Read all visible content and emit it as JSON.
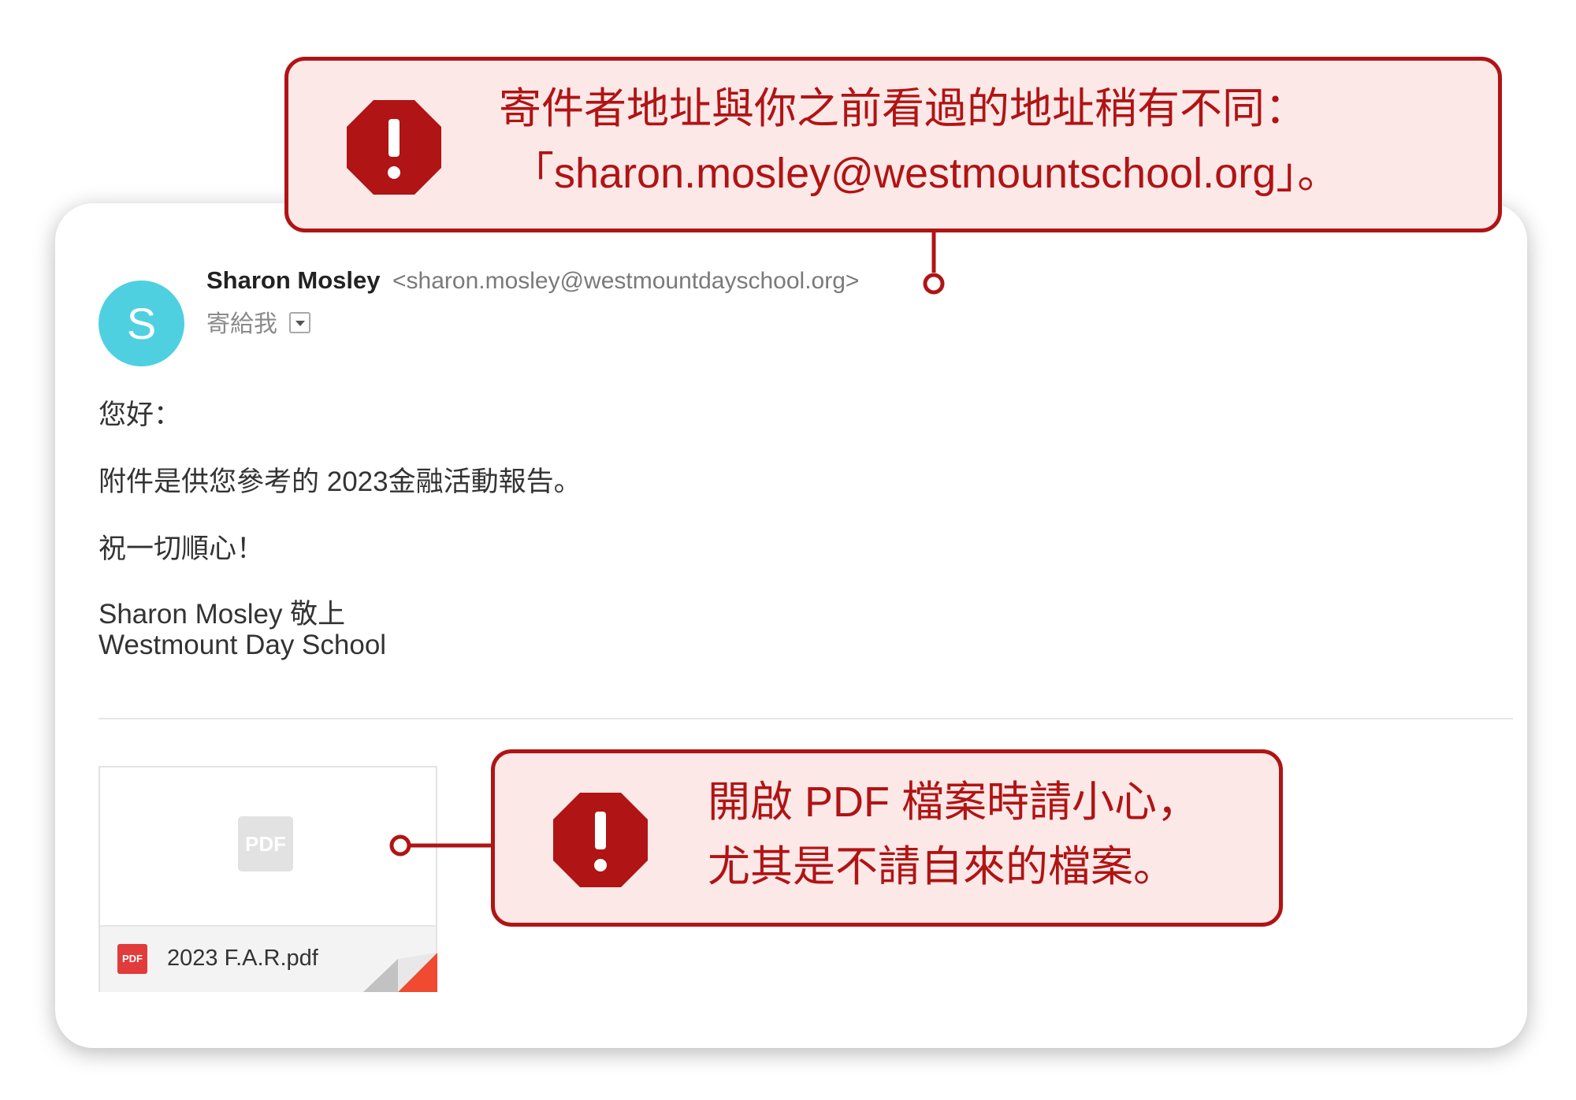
{
  "email": {
    "avatar_letter": "S",
    "sender_name": "Sharon Mosley",
    "sender_email": "<sharon.mosley@westmountdayschool.org>",
    "recipient_label": "寄給我",
    "body": {
      "greeting": "您好：",
      "line1": "附件是供您參考的 2023金融活動報告。",
      "line2": "祝一切順心！",
      "signature_name": "Sharon Mosley 敬上",
      "signature_org": "Westmount Day School"
    },
    "attachment": {
      "preview_icon_label": "PDF",
      "small_icon_label": "PDF",
      "filename": "2023 F.A.R.pdf"
    }
  },
  "warnings": {
    "sender_warning": {
      "icon": "stop-warning-icon",
      "line1": "寄件者地址與你之前看過的地址稍有不同：",
      "line2": "「sharon.mosley@westmountschool.org」。"
    },
    "attachment_warning": {
      "icon": "stop-warning-icon",
      "line1": "開啟 PDF 檔案時請小心，",
      "line2": "尤其是不請自來的檔案。"
    }
  },
  "colors": {
    "warning_red": "#b01414",
    "warning_bg": "#fde8e8",
    "avatar_cyan": "#4fd0e1",
    "pdf_red": "#e13b3b"
  }
}
